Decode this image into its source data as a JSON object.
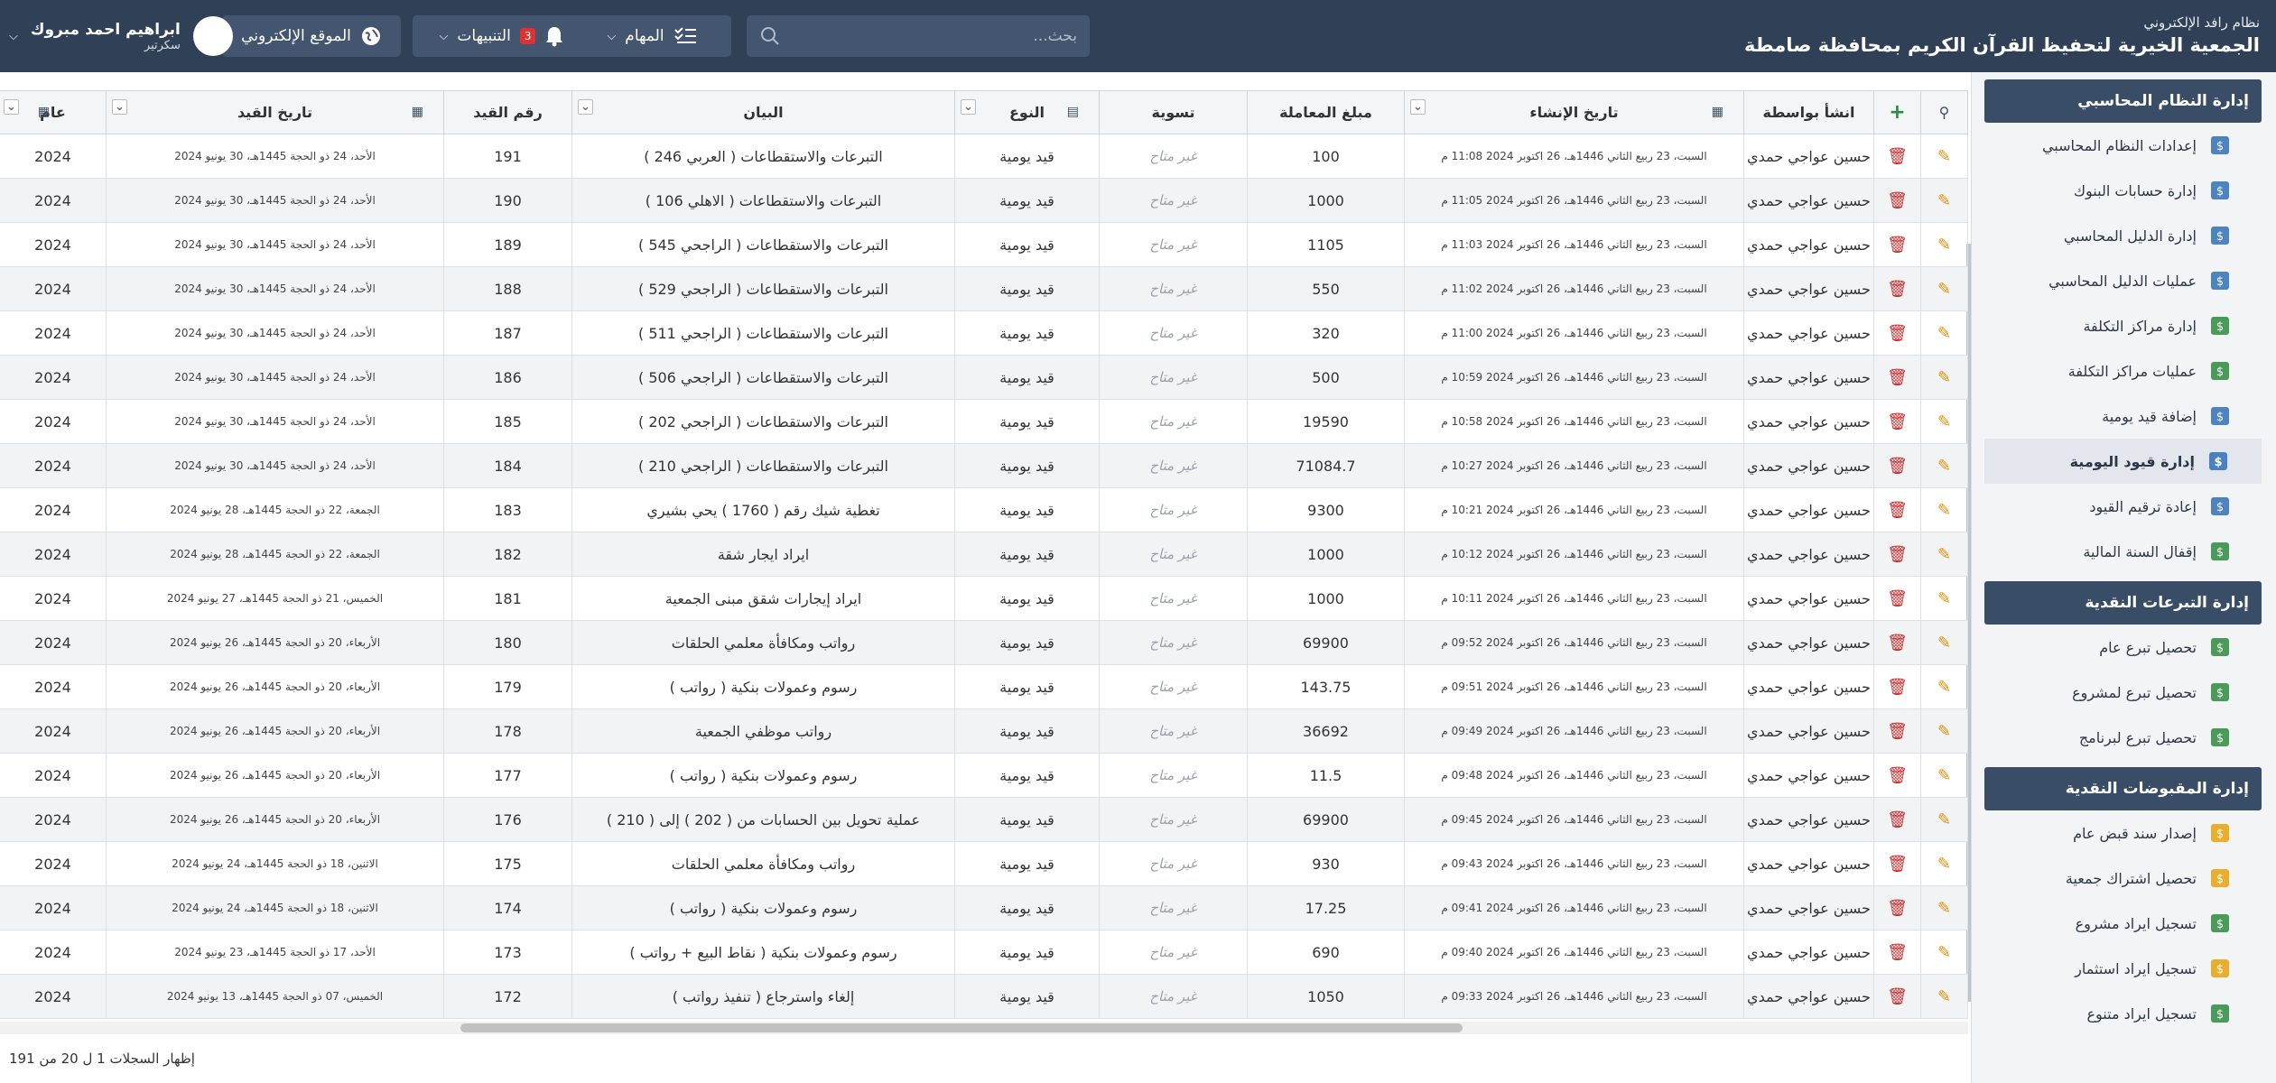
{
  "header": {
    "system_name": "نظام رافد الإلكتروني",
    "org_name": "الجمعية الخيرية لتحفيظ القرآن الكريم بمحافظة صامطة",
    "search_placeholder": "بحث...",
    "tasks_label": "المهام",
    "alerts_label": "التنبيهات",
    "alerts_count": "3",
    "website_label": "الموقع الإلكتروني",
    "user_name": "ابراهيم احمد مبروك",
    "user_role": "سكرتير"
  },
  "sidebar": {
    "sections": [
      {
        "title": "إدارة النظام المحاسبي",
        "items": [
          {
            "label": "إعدادات النظام المحاسبي",
            "icon": "gear-dollar-icon",
            "color": "#2f6fb5"
          },
          {
            "label": "إدارة حسابات البنوك",
            "icon": "bank-gear-icon",
            "color": "#2f6fb5"
          },
          {
            "label": "إدارة الدليل المحاسبي",
            "icon": "tree-icon",
            "color": "#2f6fb5"
          },
          {
            "label": "عمليات الدليل المحاسبي",
            "icon": "tree-gear-icon",
            "color": "#2f6fb5"
          },
          {
            "label": "إدارة مراكز التكلفة",
            "icon": "dollar-doc-icon",
            "color": "#2b8a3e"
          },
          {
            "label": "عمليات مراكز التكلفة",
            "icon": "dollar-doc-gear-icon",
            "color": "#2b8a3e"
          },
          {
            "label": "إضافة قيد يومية",
            "icon": "ledger-add-icon",
            "color": "#2f6fb5"
          },
          {
            "label": "إدارة قيود اليومية",
            "icon": "ledger-icon",
            "color": "#2f6fb5",
            "active": true
          },
          {
            "label": "إعادة ترقيم القيود",
            "icon": "renumber-icon",
            "color": "#2f6fb5"
          },
          {
            "label": "إقفال السنة المالية",
            "icon": "dollar-lock-icon",
            "color": "#2b8a3e"
          }
        ]
      },
      {
        "title": "إدارة التبرعات النقدية",
        "items": [
          {
            "label": "تحصيل تبرع عام",
            "icon": "gift-money-icon",
            "color": "#2b8a3e"
          },
          {
            "label": "تحصيل تبرع لمشروع",
            "icon": "money-bag-icon",
            "color": "#2b8a3e"
          },
          {
            "label": "تحصيل تبرع لبرنامج",
            "icon": "money-program-icon",
            "color": "#2b8a3e"
          }
        ]
      },
      {
        "title": "إدارة المقبوضات النقدية",
        "items": [
          {
            "label": "إصدار سند قبض عام",
            "icon": "receipt-user-icon",
            "color": "#e8a10c"
          },
          {
            "label": "تحصيل اشتراك جمعية",
            "icon": "member-fee-icon",
            "color": "#e8a10c"
          },
          {
            "label": "تسجيل ايراد مشروع",
            "icon": "project-income-icon",
            "color": "#2b8a3e"
          },
          {
            "label": "تسجيل ايراد استثمار",
            "icon": "invest-income-icon",
            "color": "#e8a10c"
          },
          {
            "label": "تسجيل ايراد متنوع",
            "icon": "misc-income-icon",
            "color": "#2b8a3e"
          }
        ]
      }
    ]
  },
  "table": {
    "columns": {
      "created_by": "انشأ بواسطة",
      "created_at": "تاريخ الإنشاء",
      "amount": "مبلغ المعاملة",
      "settlement": "تسوية",
      "type": "النوع",
      "statement": "البيان",
      "entry_no": "رقم القيد",
      "entry_date": "تاريخ القيد",
      "year": "عام"
    },
    "rows": [
      {
        "by": "حسين عواجي حمدي",
        "created": "السبت، 23 ربيع الثاني 1446هـ، 26 اكتوبر 2024 11:08 م",
        "amount": "100",
        "settle": "غير متاح",
        "type": "قيد يومية",
        "desc": "التبرعات والاستقطاعات ( العربي 246 )",
        "no": "191",
        "date": "الأحد، 24 ذو الحجة 1445هـ، 30 يونيو 2024",
        "year": "2024"
      },
      {
        "by": "حسين عواجي حمدي",
        "created": "السبت، 23 ربيع الثاني 1446هـ، 26 اكتوبر 2024 11:05 م",
        "amount": "1000",
        "settle": "غير متاح",
        "type": "قيد يومية",
        "desc": "التبرعات والاستقطاعات ( الاهلي 106 )",
        "no": "190",
        "date": "الأحد، 24 ذو الحجة 1445هـ، 30 يونيو 2024",
        "year": "2024"
      },
      {
        "by": "حسين عواجي حمدي",
        "created": "السبت، 23 ربيع الثاني 1446هـ، 26 اكتوبر 2024 11:03 م",
        "amount": "1105",
        "settle": "غير متاح",
        "type": "قيد يومية",
        "desc": "التبرعات والاستقطاعات ( الراجحي 545 )",
        "no": "189",
        "date": "الأحد، 24 ذو الحجة 1445هـ، 30 يونيو 2024",
        "year": "2024"
      },
      {
        "by": "حسين عواجي حمدي",
        "created": "السبت، 23 ربيع الثاني 1446هـ، 26 اكتوبر 2024 11:02 م",
        "amount": "550",
        "settle": "غير متاح",
        "type": "قيد يومية",
        "desc": "التبرعات والاستقطاعات ( الراجحي 529 )",
        "no": "188",
        "date": "الأحد، 24 ذو الحجة 1445هـ، 30 يونيو 2024",
        "year": "2024"
      },
      {
        "by": "حسين عواجي حمدي",
        "created": "السبت، 23 ربيع الثاني 1446هـ، 26 اكتوبر 2024 11:00 م",
        "amount": "320",
        "settle": "غير متاح",
        "type": "قيد يومية",
        "desc": "التبرعات والاستقطاعات ( الراجحي 511 )",
        "no": "187",
        "date": "الأحد، 24 ذو الحجة 1445هـ، 30 يونيو 2024",
        "year": "2024"
      },
      {
        "by": "حسين عواجي حمدي",
        "created": "السبت، 23 ربيع الثاني 1446هـ، 26 اكتوبر 2024 10:59 م",
        "amount": "500",
        "settle": "غير متاح",
        "type": "قيد يومية",
        "desc": "التبرعات والاستقطاعات ( الراجحي 506 )",
        "no": "186",
        "date": "الأحد، 24 ذو الحجة 1445هـ، 30 يونيو 2024",
        "year": "2024"
      },
      {
        "by": "حسين عواجي حمدي",
        "created": "السبت، 23 ربيع الثاني 1446هـ، 26 اكتوبر 2024 10:58 م",
        "amount": "19590",
        "settle": "غير متاح",
        "type": "قيد يومية",
        "desc": "التبرعات والاستقطاعات ( الراجحي 202 )",
        "no": "185",
        "date": "الأحد، 24 ذو الحجة 1445هـ، 30 يونيو 2024",
        "year": "2024"
      },
      {
        "by": "حسين عواجي حمدي",
        "created": "السبت، 23 ربيع الثاني 1446هـ، 26 اكتوبر 2024 10:27 م",
        "amount": "71084.7",
        "settle": "غير متاح",
        "type": "قيد يومية",
        "desc": "التبرعات والاستقطاعات ( الراجحي 210 )",
        "no": "184",
        "date": "الأحد، 24 ذو الحجة 1445هـ، 30 يونيو 2024",
        "year": "2024"
      },
      {
        "by": "حسين عواجي حمدي",
        "created": "السبت، 23 ربيع الثاني 1446هـ، 26 اكتوبر 2024 10:21 م",
        "amount": "9300",
        "settle": "غير متاح",
        "type": "قيد يومية",
        "desc": "تغطية شيك رقم ( 1760 ) يحي بشيري",
        "no": "183",
        "date": "الجمعة، 22 ذو الحجة 1445هـ، 28 يونيو 2024",
        "year": "2024"
      },
      {
        "by": "حسين عواجي حمدي",
        "created": "السبت، 23 ربيع الثاني 1446هـ، 26 اكتوبر 2024 10:12 م",
        "amount": "1000",
        "settle": "غير متاح",
        "type": "قيد يومية",
        "desc": "ايراد ايجار شقة",
        "no": "182",
        "date": "الجمعة، 22 ذو الحجة 1445هـ، 28 يونيو 2024",
        "year": "2024"
      },
      {
        "by": "حسين عواجي حمدي",
        "created": "السبت، 23 ربيع الثاني 1446هـ، 26 اكتوبر 2024 10:11 م",
        "amount": "1000",
        "settle": "غير متاح",
        "type": "قيد يومية",
        "desc": "ايراد إيجارات شقق مبنى الجمعية",
        "no": "181",
        "date": "الخميس، 21 ذو الحجة 1445هـ، 27 يونيو 2024",
        "year": "2024"
      },
      {
        "by": "حسين عواجي حمدي",
        "created": "السبت، 23 ربيع الثاني 1446هـ، 26 اكتوبر 2024 09:52 م",
        "amount": "69900",
        "settle": "غير متاح",
        "type": "قيد يومية",
        "desc": "رواتب ومكافأة معلمي الحلقات",
        "no": "180",
        "date": "الأربعاء، 20 ذو الحجة 1445هـ، 26 يونيو 2024",
        "year": "2024"
      },
      {
        "by": "حسين عواجي حمدي",
        "created": "السبت، 23 ربيع الثاني 1446هـ، 26 اكتوبر 2024 09:51 م",
        "amount": "143.75",
        "settle": "غير متاح",
        "type": "قيد يومية",
        "desc": "رسوم وعمولات بنكية ( رواتب )",
        "no": "179",
        "date": "الأربعاء، 20 ذو الحجة 1445هـ، 26 يونيو 2024",
        "year": "2024"
      },
      {
        "by": "حسين عواجي حمدي",
        "created": "السبت، 23 ربيع الثاني 1446هـ، 26 اكتوبر 2024 09:49 م",
        "amount": "36692",
        "settle": "غير متاح",
        "type": "قيد يومية",
        "desc": "رواتب موظفي الجمعية",
        "no": "178",
        "date": "الأربعاء، 20 ذو الحجة 1445هـ، 26 يونيو 2024",
        "year": "2024"
      },
      {
        "by": "حسين عواجي حمدي",
        "created": "السبت، 23 ربيع الثاني 1446هـ، 26 اكتوبر 2024 09:48 م",
        "amount": "11.5",
        "settle": "غير متاح",
        "type": "قيد يومية",
        "desc": "رسوم وعمولات بنكية ( رواتب )",
        "no": "177",
        "date": "الأربعاء، 20 ذو الحجة 1445هـ، 26 يونيو 2024",
        "year": "2024"
      },
      {
        "by": "حسين عواجي حمدي",
        "created": "السبت، 23 ربيع الثاني 1446هـ، 26 اكتوبر 2024 09:45 م",
        "amount": "69900",
        "settle": "غير متاح",
        "type": "قيد يومية",
        "desc": "عملية تحويل بين الحسابات من ( 202 ) إلى ( 210 )",
        "no": "176",
        "date": "الأربعاء، 20 ذو الحجة 1445هـ، 26 يونيو 2024",
        "year": "2024"
      },
      {
        "by": "حسين عواجي حمدي",
        "created": "السبت، 23 ربيع الثاني 1446هـ، 26 اكتوبر 2024 09:43 م",
        "amount": "930",
        "settle": "غير متاح",
        "type": "قيد يومية",
        "desc": "رواتب ومكافأة معلمي الحلقات",
        "no": "175",
        "date": "الاثنين، 18 ذو الحجة 1445هـ، 24 يونيو 2024",
        "year": "2024"
      },
      {
        "by": "حسين عواجي حمدي",
        "created": "السبت، 23 ربيع الثاني 1446هـ، 26 اكتوبر 2024 09:41 م",
        "amount": "17.25",
        "settle": "غير متاح",
        "type": "قيد يومية",
        "desc": "رسوم وعمولات بنكية ( رواتب )",
        "no": "174",
        "date": "الاثنين، 18 ذو الحجة 1445هـ، 24 يونيو 2024",
        "year": "2024"
      },
      {
        "by": "حسين عواجي حمدي",
        "created": "السبت، 23 ربيع الثاني 1446هـ، 26 اكتوبر 2024 09:40 م",
        "amount": "690",
        "settle": "غير متاح",
        "type": "قيد يومية",
        "desc": "رسوم وعمولات بنكية ( نقاط البيع + رواتب )",
        "no": "173",
        "date": "الأحد، 17 ذو الحجة 1445هـ، 23 يونيو 2024",
        "year": "2024"
      },
      {
        "by": "حسين عواجي حمدي",
        "created": "السبت، 23 ربيع الثاني 1446هـ، 26 اكتوبر 2024 09:33 م",
        "amount": "1050",
        "settle": "غير متاح",
        "type": "قيد يومية",
        "desc": "إلغاء واسترجاع ( تنفيذ رواتب )",
        "no": "172",
        "date": "الخميس، 07 ذو الحجة 1445هـ، 13 يونيو 2024",
        "year": "2024"
      }
    ],
    "footer_text": "إظهار السجلات 1 ل 20 من 191"
  }
}
